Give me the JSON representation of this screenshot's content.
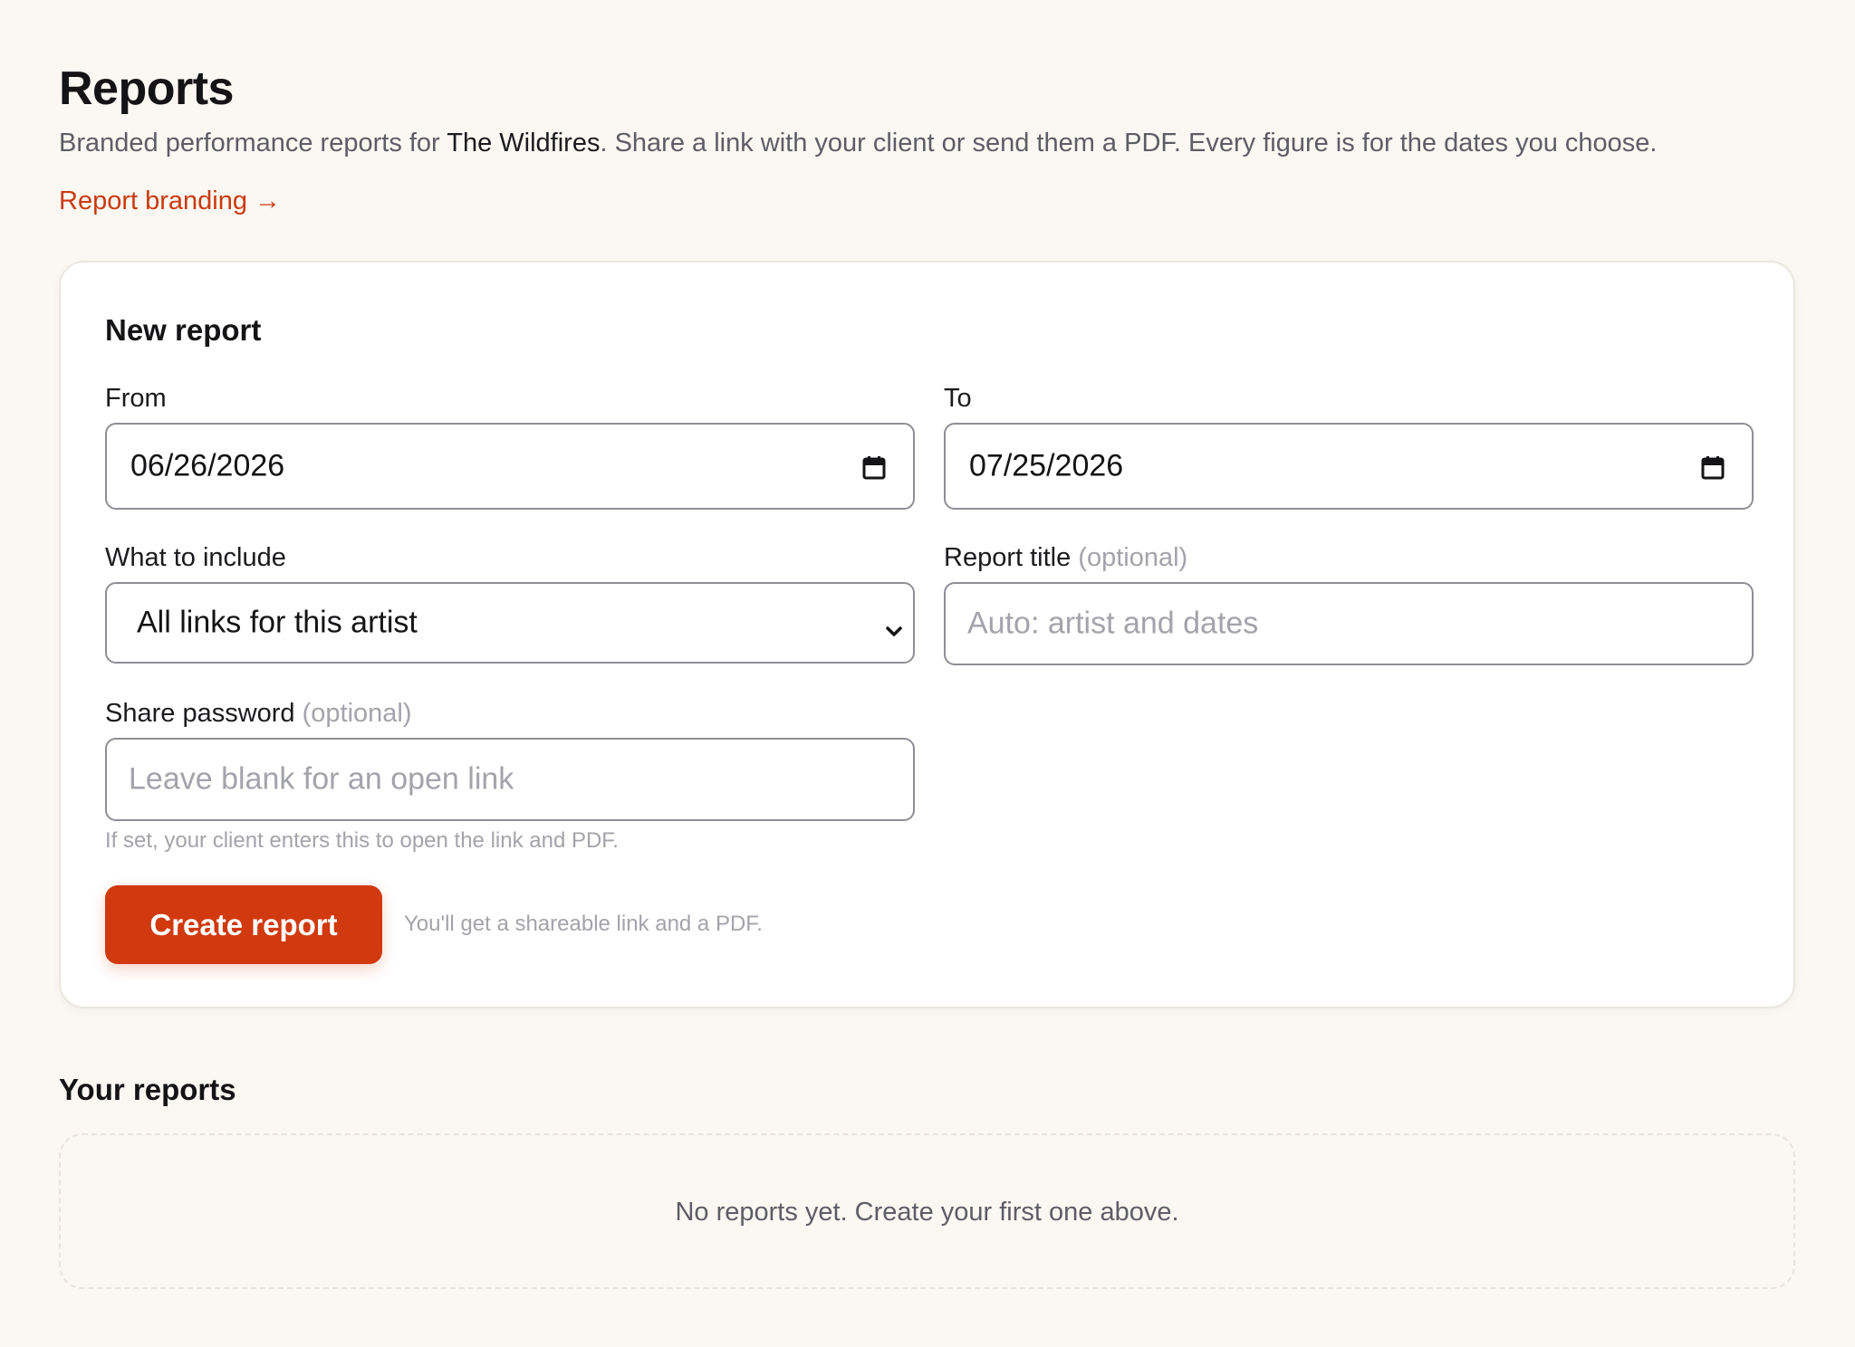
{
  "header": {
    "title": "Reports",
    "subtitle_before": "Branded performance reports for ",
    "artist": "The Wildfires",
    "subtitle_after": ". Share a link with your client or send them a PDF. Every figure is for the dates you choose.",
    "branding_link": "Report branding →"
  },
  "new_report": {
    "title": "New report",
    "from": {
      "label": "From",
      "value": "06/26/2026",
      "icon": "calendar-icon"
    },
    "to": {
      "label": "To",
      "value": "07/25/2026",
      "icon": "calendar-icon"
    },
    "include": {
      "label": "What to include",
      "value": "All links for this artist",
      "icon": "chevron-down-icon"
    },
    "report_title": {
      "label": "Report title",
      "optional": "(optional)",
      "placeholder": "Auto: artist and dates",
      "value": ""
    },
    "share_password": {
      "label": "Share password",
      "optional": "(optional)",
      "placeholder": "Leave blank for an open link",
      "value": "",
      "hint": "If set, your client enters this to open the link and PDF."
    },
    "create_button": "Create report",
    "create_hint": "You'll get a shareable link and a PDF."
  },
  "your_reports": {
    "title": "Your reports",
    "empty_message": "No reports yet. Create your first one above."
  },
  "colors": {
    "background": "#fbf7f2",
    "accent": "#d1390e",
    "link": "#c93a10",
    "muted_text": "#a3a3ab"
  }
}
